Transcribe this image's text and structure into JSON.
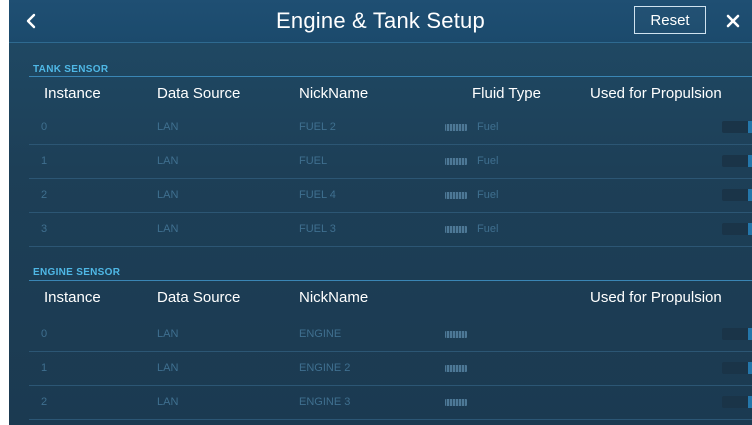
{
  "header": {
    "title": "Engine & Tank Setup",
    "reset_label": "Reset"
  },
  "colors": {
    "background": "#1d3f57",
    "accent": "#4fb8e6",
    "toggle_on": "#2476aa"
  },
  "tank_section": {
    "label": "TANK SENSOR",
    "columns": {
      "instance": "Instance",
      "data_source": "Data Source",
      "nickname": "NickName",
      "fluid_type": "Fluid Type",
      "propulsion": "Used for Propulsion"
    },
    "rows": [
      {
        "instance": "0",
        "data_source": "LAN",
        "nickname": "FUEL 2",
        "fluid_type": "Fuel",
        "propulsion": "ON"
      },
      {
        "instance": "1",
        "data_source": "LAN",
        "nickname": "FUEL",
        "fluid_type": "Fuel",
        "propulsion": "ON"
      },
      {
        "instance": "2",
        "data_source": "LAN",
        "nickname": "FUEL 4",
        "fluid_type": "Fuel",
        "propulsion": "ON"
      },
      {
        "instance": "3",
        "data_source": "LAN",
        "nickname": "FUEL 3",
        "fluid_type": "Fuel",
        "propulsion": "ON"
      }
    ]
  },
  "engine_section": {
    "label": "ENGINE SENSOR",
    "columns": {
      "instance": "Instance",
      "data_source": "Data Source",
      "nickname": "NickName",
      "propulsion": "Used for Propulsion"
    },
    "rows": [
      {
        "instance": "0",
        "data_source": "LAN",
        "nickname": "ENGINE",
        "propulsion": "ON"
      },
      {
        "instance": "1",
        "data_source": "LAN",
        "nickname": "ENGINE 2",
        "propulsion": "ON"
      },
      {
        "instance": "2",
        "data_source": "LAN",
        "nickname": "ENGINE 3",
        "propulsion": "ON"
      }
    ]
  }
}
